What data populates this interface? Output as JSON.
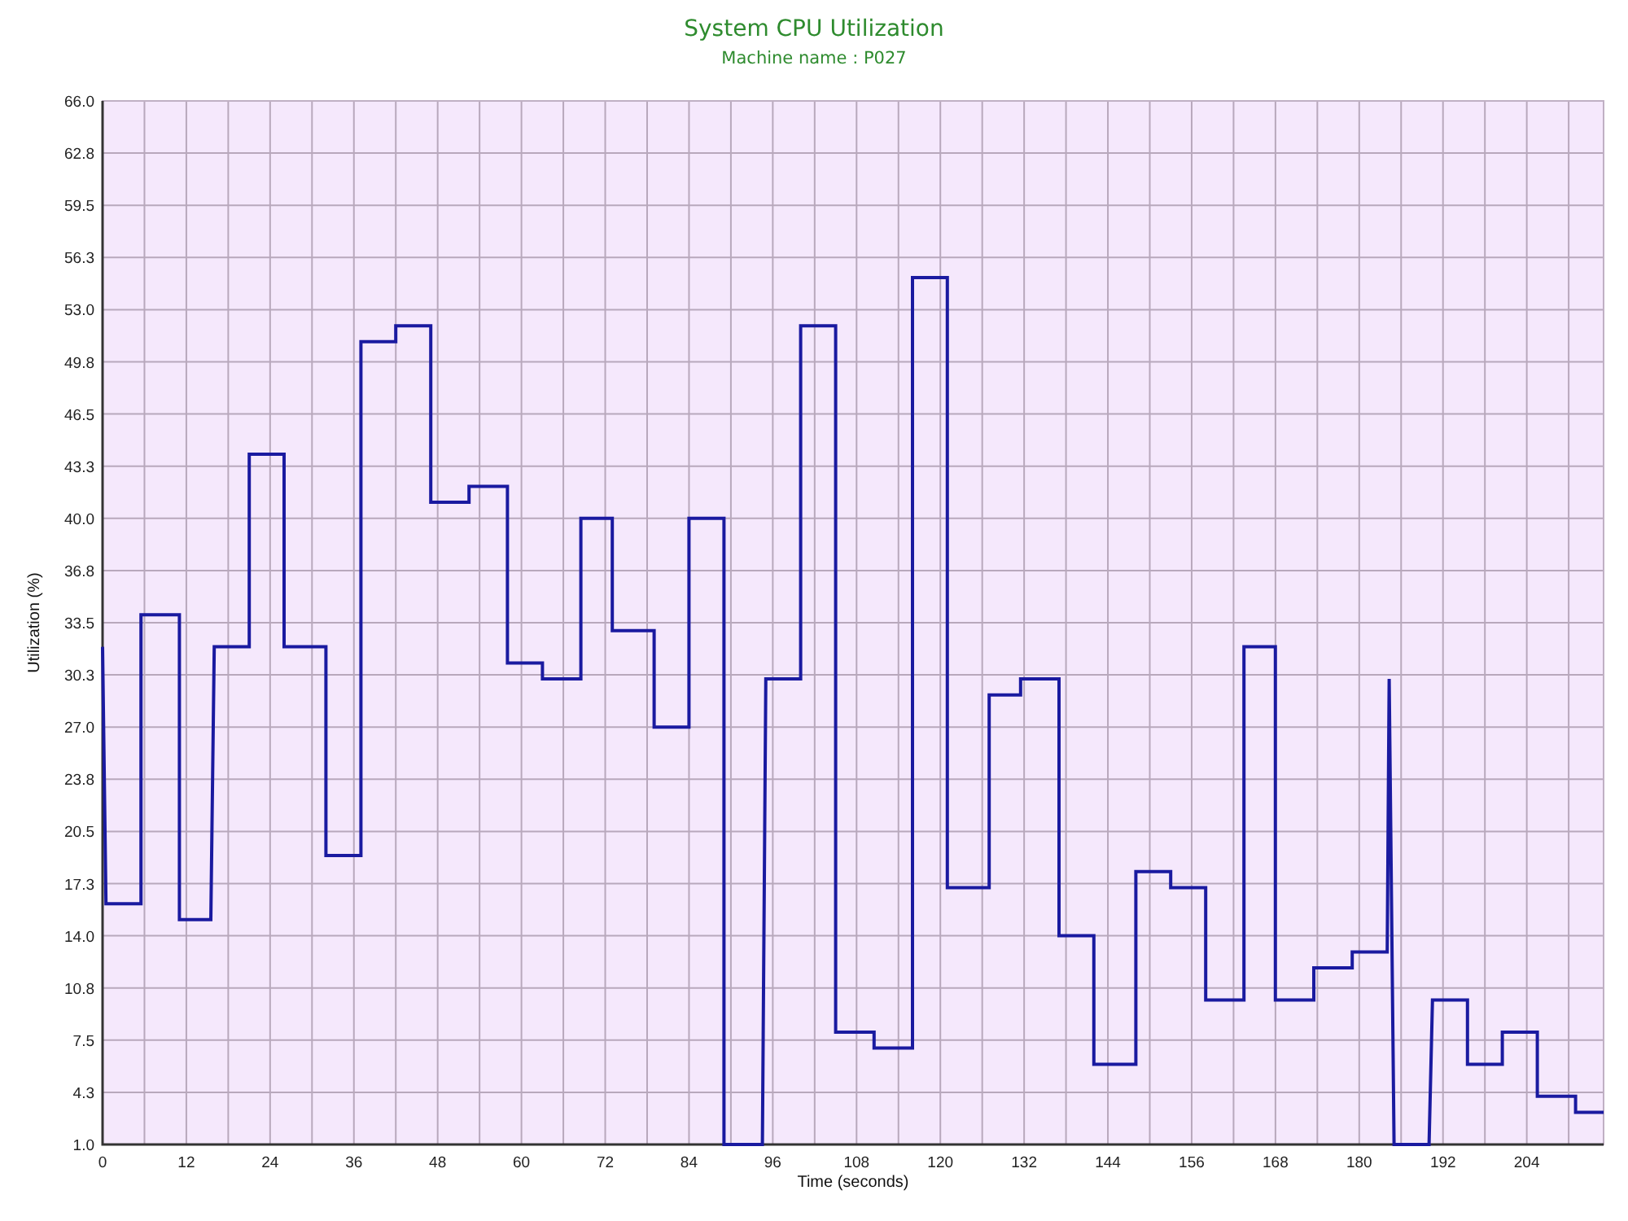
{
  "chart": {
    "subtitle": "Machine name : P027",
    "chart_data": {
      "type": "line",
      "title": "System CPU Utilization",
      "xlabel": "Time (seconds)",
      "ylabel": "Utilization (%)",
      "grid": true,
      "xlim": [
        0,
        215
      ],
      "ylim": [
        1,
        66
      ],
      "xticks": [
        0,
        12,
        24,
        36,
        48,
        60,
        72,
        84,
        96,
        108,
        120,
        132,
        144,
        156,
        168,
        180,
        192,
        204
      ],
      "yticks": [
        {
          "value": 1,
          "label": "1.0"
        },
        {
          "value": 4.25,
          "label": "4.3"
        },
        {
          "value": 7.5,
          "label": "7.5"
        },
        {
          "value": 10.75,
          "label": "10.8"
        },
        {
          "value": 14,
          "label": "14.0"
        },
        {
          "value": 17.25,
          "label": "17.3"
        },
        {
          "value": 20.5,
          "label": "20.5"
        },
        {
          "value": 23.75,
          "label": "23.8"
        },
        {
          "value": 27,
          "label": "27.0"
        },
        {
          "value": 30.25,
          "label": "30.3"
        },
        {
          "value": 33.5,
          "label": "33.5"
        },
        {
          "value": 36.75,
          "label": "36.8"
        },
        {
          "value": 40,
          "label": "40.0"
        },
        {
          "value": 43.25,
          "label": "43.3"
        },
        {
          "value": 46.5,
          "label": "46.5"
        },
        {
          "value": 49.75,
          "label": "49.8"
        },
        {
          "value": 53,
          "label": "53.0"
        },
        {
          "value": 56.25,
          "label": "56.3"
        },
        {
          "value": 59.5,
          "label": "59.5"
        },
        {
          "value": 62.75,
          "label": "62.8"
        },
        {
          "value": 66,
          "label": "66.0"
        }
      ],
      "x": [
        0,
        0.5,
        5.5,
        5.5,
        11,
        11,
        15.5,
        16,
        21,
        21,
        26,
        26,
        32,
        32,
        37,
        37,
        42,
        42,
        47,
        47,
        52.5,
        52.5,
        58,
        58,
        63,
        63,
        68.5,
        68.5,
        73,
        73,
        79,
        79,
        84,
        84,
        89,
        89,
        94.5,
        95,
        100,
        100,
        105,
        105,
        110.5,
        110.5,
        116,
        116,
        121,
        121,
        127,
        127,
        131.5,
        131.5,
        137,
        137,
        142,
        142,
        148,
        148,
        153,
        153,
        158,
        158,
        163.5,
        163.5,
        168,
        168,
        173.5,
        173.5,
        179,
        179,
        184,
        184.3,
        185,
        190,
        190.5,
        195.5,
        195.5,
        200.5,
        200.5,
        205.5,
        205.5,
        211,
        211,
        215
      ],
      "series": [
        {
          "color": "#1a1aa0",
          "values": [
            32,
            16,
            16,
            34,
            34,
            15,
            15,
            32,
            32,
            44,
            44,
            32,
            32,
            19,
            19,
            51,
            51,
            52,
            52,
            41,
            41,
            42,
            42,
            31,
            31,
            30,
            30,
            40,
            40,
            33,
            33,
            27,
            27,
            40,
            40,
            1,
            1,
            30,
            30,
            52,
            52,
            8,
            8,
            7,
            7,
            55,
            55,
            17,
            17,
            29,
            29,
            30,
            30,
            14,
            14,
            6,
            6,
            18,
            18,
            17,
            17,
            10,
            10,
            32,
            32,
            10,
            10,
            12,
            12,
            13,
            13,
            30,
            1,
            1,
            10,
            10,
            6,
            6,
            8,
            8,
            4,
            4,
            3,
            3
          ]
        }
      ]
    }
  }
}
